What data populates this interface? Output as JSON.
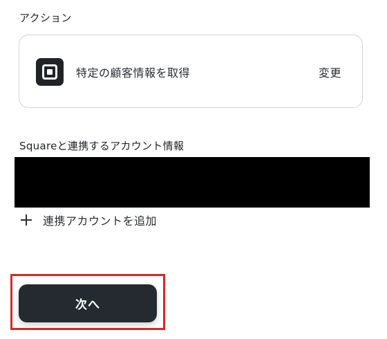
{
  "action_section": {
    "label": "アクション",
    "card": {
      "app_icon": "square-logo-icon",
      "action_name": "特定の顧客情報を取得",
      "change_label": "変更"
    }
  },
  "account_section": {
    "label": "Squareと連携するアカウント情報",
    "add_account_label": "連携アカウントを追加",
    "add_icon": "plus-icon"
  },
  "footer": {
    "next_label": "次へ",
    "highlight_color": "#dc2626",
    "button_color": "#252a31"
  }
}
